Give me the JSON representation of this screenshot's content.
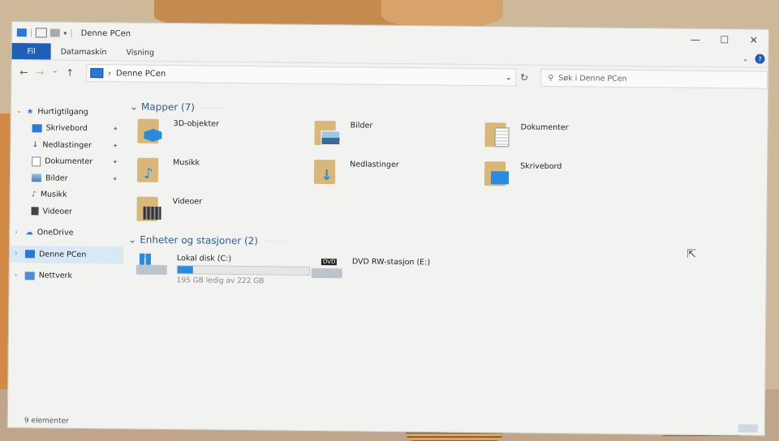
{
  "window": {
    "title": "Denne PCen",
    "controls": [
      "—",
      "☐",
      "✕"
    ]
  },
  "ribbon": {
    "tabs": [
      "Fil",
      "Datamaskin",
      "Visning"
    ]
  },
  "address": {
    "path": "Denne PCen",
    "search_placeholder": "Søk i Denne PCen"
  },
  "sidebar": {
    "quick_access": "Hurtigtilgang",
    "pinned": [
      {
        "label": "Skrivebord",
        "icon": "desktop-icon"
      },
      {
        "label": "Nedlastinger",
        "icon": "download-icon"
      },
      {
        "label": "Dokumenter",
        "icon": "document-icon"
      },
      {
        "label": "Bilder",
        "icon": "pictures-icon"
      }
    ],
    "recent": [
      {
        "label": "Musikk",
        "icon": "music-icon"
      },
      {
        "label": "Videoer",
        "icon": "video-icon"
      }
    ],
    "onedrive": "OneDrive",
    "this_pc": "Denne PCen",
    "network": "Nettverk"
  },
  "folders": {
    "header": "Mapper (7)",
    "items": [
      {
        "label": "3D-objekter",
        "icon": "3d-objects-icon"
      },
      {
        "label": "Bilder",
        "icon": "pictures-icon"
      },
      {
        "label": "Dokumenter",
        "icon": "document-icon"
      },
      {
        "label": "Musikk",
        "icon": "music-icon"
      },
      {
        "label": "Nedlastinger",
        "icon": "download-icon"
      },
      {
        "label": "Skrivebord",
        "icon": "desktop-icon"
      },
      {
        "label": "Videoer",
        "icon": "video-icon"
      }
    ]
  },
  "devices": {
    "header": "Enheter og stasjoner (2)",
    "local_disk": {
      "label": "Lokal disk (C:)",
      "free": "195 GB ledig av 222 GB",
      "used_fraction": 0.12
    },
    "dvd": {
      "label": "DVD RW-stasjon (E:)",
      "badge": "DVD"
    }
  },
  "status": {
    "count": "9 elementer"
  },
  "colors": {
    "accent": "#1f5fb8",
    "header_blue": "#2b5c9c",
    "drive_bar": "#2a8ae0"
  }
}
